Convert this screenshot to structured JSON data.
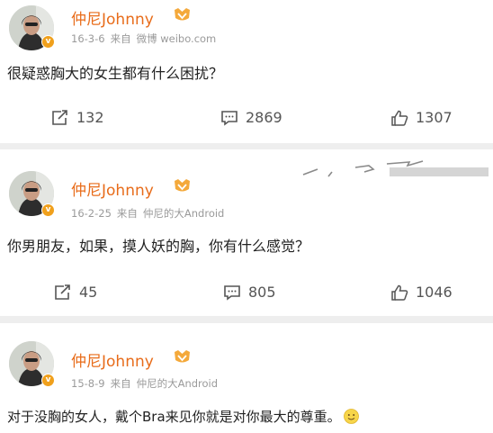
{
  "posts": [
    {
      "username": "仲尼Johnny",
      "date": "16-3-6",
      "source_prefix": "来自",
      "source": "微博 weibo.com",
      "text": "很疑惑胸大的女生都有什么困扰？",
      "reposts": "132",
      "comments": "2869",
      "likes": "1307"
    },
    {
      "username": "仲尼Johnny",
      "date": "16-2-25",
      "source_prefix": "来自",
      "source": "仲尼的大Android",
      "text": "你男朋友，如果，摸人妖的胸，你有什么感觉？",
      "reposts": "45",
      "comments": "805",
      "likes": "1046"
    },
    {
      "username": "仲尼Johnny",
      "date": "15-8-9",
      "source_prefix": "来自",
      "source": "仲尼的大Android",
      "text": "对于没胸的女人，戴个Bra来见你就是对你最大的尊重。",
      "emoji": "smile-icon"
    }
  ],
  "colors": {
    "username": "#e86c1a",
    "meta": "#9a9a9a",
    "text": "#222222",
    "action": "#555555",
    "verified_badge": "#f0a01c",
    "background": "#eeeeee"
  },
  "icons": {
    "repost": "repost-icon",
    "comment": "comment-icon",
    "like": "thumbs-up-icon",
    "verified": "verified-badge-icon",
    "member": "member-badge-icon"
  }
}
